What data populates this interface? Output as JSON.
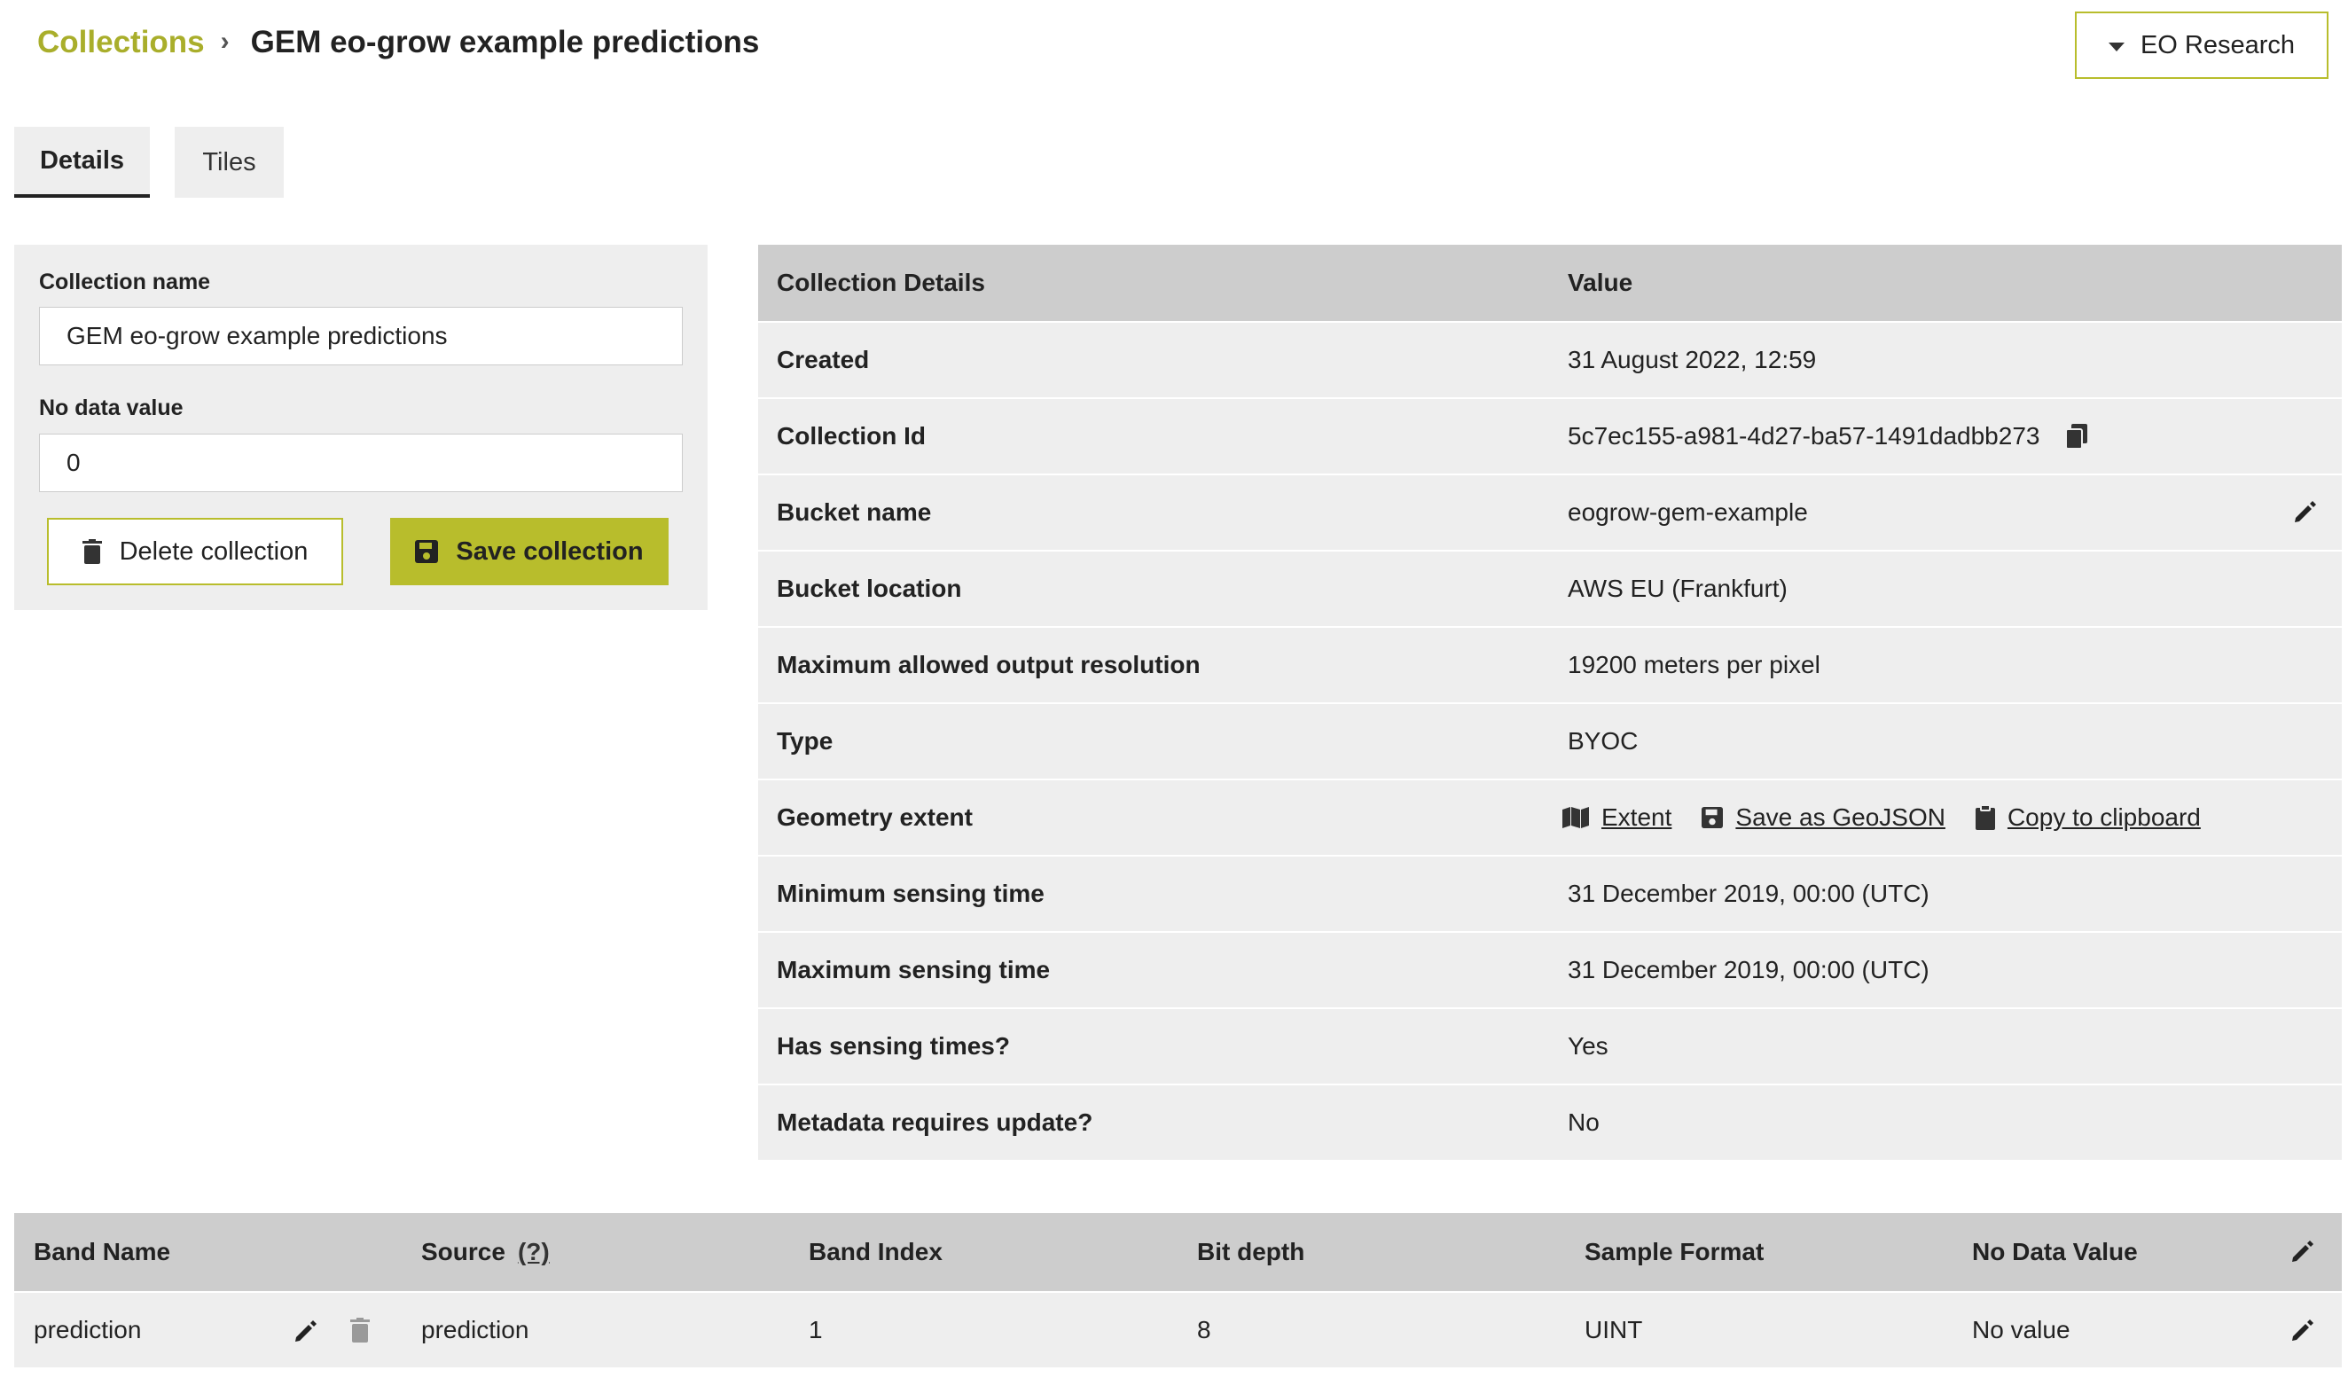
{
  "breadcrumb": {
    "root": "Collections",
    "separator": "›",
    "current": "GEM eo-grow example predictions"
  },
  "account": {
    "label": "EO Research"
  },
  "tabs": [
    {
      "label": "Details",
      "active": true
    },
    {
      "label": "Tiles",
      "active": false
    }
  ],
  "form": {
    "collection_name_label": "Collection name",
    "collection_name_value": "GEM eo-grow example predictions",
    "no_data_label": "No data value",
    "no_data_value": "0",
    "delete_label": "Delete collection",
    "save_label": "Save collection"
  },
  "details": {
    "header": {
      "key": "Collection Details",
      "value": "Value"
    },
    "rows": [
      {
        "key": "Created",
        "value": "31 August 2022, 12:59"
      },
      {
        "key": "Collection Id",
        "value": "5c7ec155-a981-4d27-ba57-1491dadbb273"
      },
      {
        "key": "Bucket name",
        "value": "eogrow-gem-example"
      },
      {
        "key": "Bucket location",
        "value": "AWS EU (Frankfurt)"
      },
      {
        "key": "Maximum allowed output resolution",
        "value": "19200 meters per pixel"
      },
      {
        "key": "Type",
        "value": "BYOC"
      },
      {
        "key": "Geometry extent",
        "links": [
          "Extent",
          "Save as GeoJSON",
          "Copy to clipboard"
        ]
      },
      {
        "key": "Minimum sensing time",
        "value": "31 December 2019, 00:00 (UTC)"
      },
      {
        "key": "Maximum sensing time",
        "value": "31 December 2019, 00:00 (UTC)"
      },
      {
        "key": "Has sensing times?",
        "value": "Yes"
      },
      {
        "key": "Metadata requires update?",
        "value": "No"
      }
    ]
  },
  "bands": {
    "columns": [
      "Band Name",
      "Source",
      "Band Index",
      "Bit depth",
      "Sample Format",
      "No Data Value"
    ],
    "source_help": "(?)",
    "rows": [
      {
        "band_name": "prediction",
        "source": "prediction",
        "band_index": "1",
        "bit_depth": "8",
        "sample_format": "UINT",
        "no_data_value": "No value"
      }
    ]
  },
  "colors": {
    "accent": "#b8bd2c",
    "link_accent": "#a9ae2b",
    "row_bg": "#eeeeee",
    "header_bg": "#cdcdcd"
  }
}
